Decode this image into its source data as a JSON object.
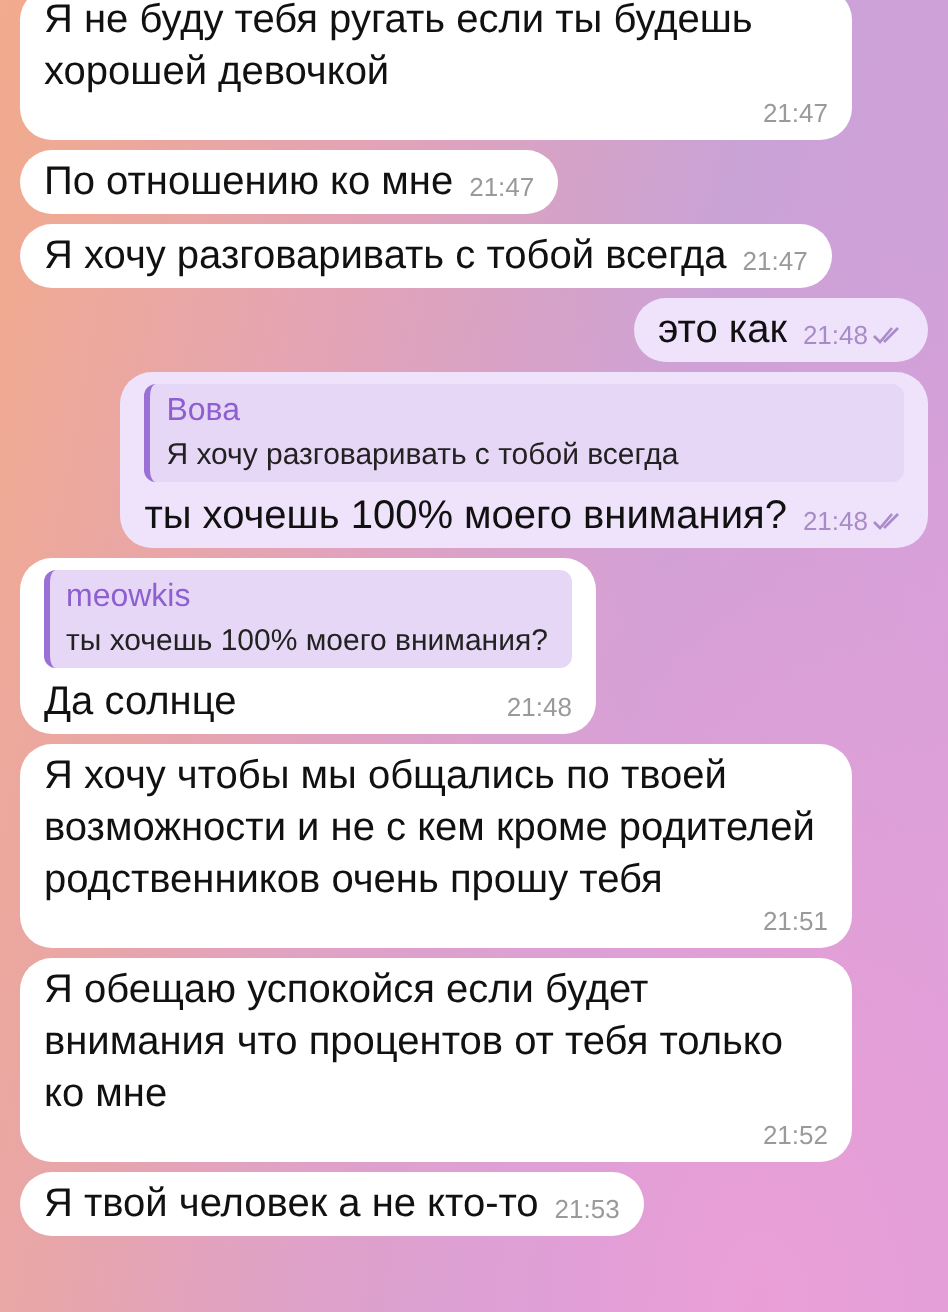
{
  "messages": [
    {
      "kind": "incoming",
      "text": "Я не буду тебя ругать если ты будешь хорошей девочкой",
      "time": "21:47"
    },
    {
      "kind": "incoming",
      "text": "По отношению ко мне",
      "time": "21:47"
    },
    {
      "kind": "incoming",
      "text": "Я хочу разговаривать с тобой всегда",
      "time": "21:47"
    },
    {
      "kind": "outgoing",
      "text": "это как",
      "time": "21:48",
      "read": true
    },
    {
      "kind": "outgoing",
      "reply": {
        "name": "Вова",
        "text": "Я хочу разговаривать с тобой всегда"
      },
      "text": "ты хочешь 100% моего внимания?",
      "time": "21:48",
      "read": true
    },
    {
      "kind": "incoming",
      "reply": {
        "name": "meowkis",
        "text": "ты хочешь 100% моего внимания?"
      },
      "text": "Да солнце",
      "time": "21:48"
    },
    {
      "kind": "incoming",
      "text": "Я хочу чтобы мы общались по твоей возможности и не с кем кроме родителей родственников очень прошу тебя",
      "time": "21:51"
    },
    {
      "kind": "incoming",
      "text": "Я обещаю успокойся если будет внимания что процентов от тебя только ко мне",
      "time": "21:52"
    },
    {
      "kind": "incoming",
      "text": "Я твой человек а не кто-то",
      "time": "21:53"
    }
  ]
}
